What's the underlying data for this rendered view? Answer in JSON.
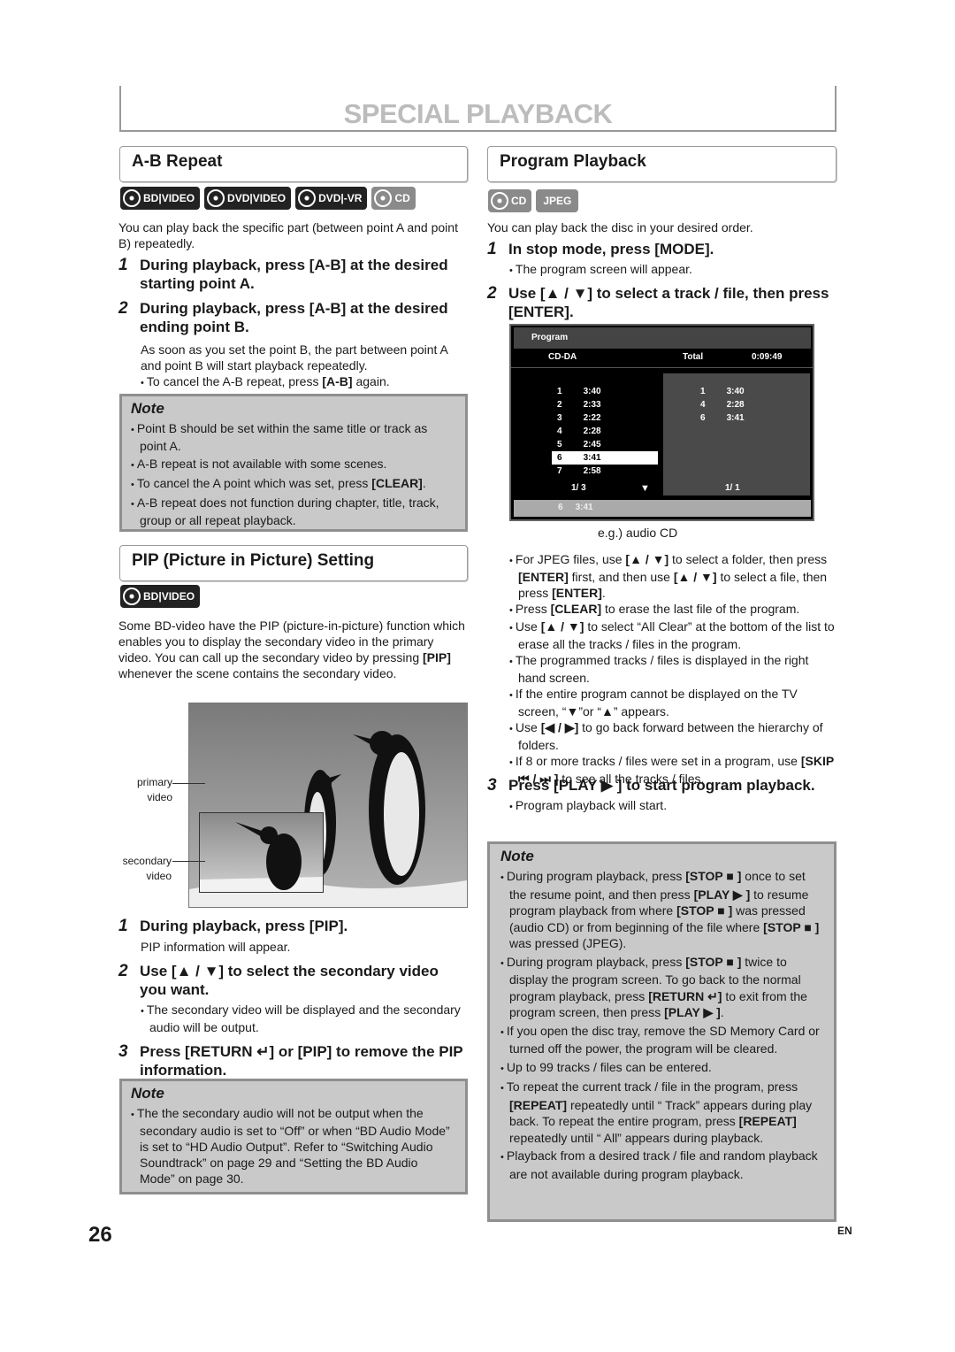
{
  "page_title": "SPECIAL PLAYBACK",
  "ab": {
    "title": "A-B Repeat",
    "discs": [
      "BD|VIDEO",
      "DVD|VIDEO",
      "DVD|-VR",
      "CD"
    ],
    "intro": "You can play back the specific part (between point A and point B) repeatedly.",
    "step1": {
      "n": "1",
      "text": "During playback, press [A-B] at the desired starting point A."
    },
    "step2": {
      "n": "2",
      "text": "During playback, press [A-B] at the desired ending point B."
    },
    "step2_body": "As soon as you set the point B, the part between point A and point B will start playback repeatedly.",
    "step2_bullet": [
      [
        "To cancel the A-B repeat, press ",
        0
      ],
      [
        "[A-B]",
        1
      ],
      [
        " again.",
        0
      ]
    ],
    "note_title": "Note",
    "notes": [
      [
        [
          "Point B should be set within the same title or track as point A.",
          0
        ]
      ],
      [
        [
          "A-B repeat is not available with some scenes.",
          0
        ]
      ],
      [
        [
          "To cancel the A point which was set, press ",
          0
        ],
        [
          "[CLEAR]",
          1
        ],
        [
          ".",
          0
        ]
      ],
      [
        [
          "A-B repeat does not function during chapter, title, track, group or all repeat playback.",
          0
        ]
      ]
    ]
  },
  "pip": {
    "title": "PIP (Picture in Picture) Setting",
    "discs": [
      "BD|VIDEO"
    ],
    "intro": [
      [
        "Some BD-video have the PIP (picture-in-picture) function which enables you to display the secondary video in the primary video. You can call up the secondary video by pressing ",
        0
      ],
      [
        "[PIP]",
        1
      ],
      [
        " whenever the scene contains the secondary video.",
        0
      ]
    ],
    "label_primary": "primary video",
    "label_secondary": "secondary video",
    "step1": {
      "n": "1",
      "text": "During playback, press [PIP]."
    },
    "step1_body": "PIP information will appear.",
    "step2": {
      "n": "2",
      "text": "Use [▲ / ▼] to select the secondary video you want."
    },
    "step2_bullet": "The secondary video will be displayed and the secondary audio will be output.",
    "step3": {
      "n": "3",
      "text": "Press [RETURN ↵] or [PIP] to remove the PIP information."
    },
    "note_title": "Note",
    "notes": [
      [
        [
          "The the secondary audio will not be output when the secondary audio is set to “Off” or when “BD Audio Mode” is set to “HD Audio Output”. Refer to “Switching Audio Soundtrack” on page 29 and “Setting the BD Audio Mode” on page 30.",
          0
        ]
      ]
    ]
  },
  "program": {
    "title": "Program Playback",
    "discs": [
      "CD",
      "JPEG"
    ],
    "intro": "You can play back the disc in your desired order.",
    "step1": {
      "n": "1",
      "text": "In stop mode, press [MODE]."
    },
    "step1_bullet": "The program screen will appear.",
    "step2": {
      "n": "2",
      "text": "Use [▲ / ▼] to select a track / file, then press [ENTER]."
    },
    "screen": {
      "header": "Program",
      "disc_type": "CD-DA",
      "total_label": "Total",
      "total_time": "0:09:49",
      "tracks": [
        [
          "1",
          "3:40"
        ],
        [
          "2",
          "2:33"
        ],
        [
          "3",
          "2:22"
        ],
        [
          "4",
          "2:28"
        ],
        [
          "5",
          "2:45"
        ],
        [
          "6",
          "3:41"
        ],
        [
          "7",
          "2:58"
        ]
      ],
      "selected_index": 5,
      "left_page": "1/  3",
      "programmed": [
        [
          "1",
          "3:40"
        ],
        [
          "4",
          "2:28"
        ],
        [
          "6",
          "3:41"
        ]
      ],
      "right_page": "1/  1",
      "current": [
        "6",
        "3:41"
      ]
    },
    "caption": "e.g.) audio CD",
    "bullets": [
      [
        [
          "For JPEG files, use ",
          0
        ],
        [
          "[▲ / ▼]",
          1
        ],
        [
          " to select a folder, then press ",
          0
        ],
        [
          "[ENTER]",
          1
        ],
        [
          " first, and then use ",
          0
        ],
        [
          "[▲ / ▼]",
          1
        ],
        [
          " to select a file, then press ",
          0
        ],
        [
          "[ENTER]",
          1
        ],
        [
          ".",
          0
        ]
      ],
      [
        [
          "Press ",
          0
        ],
        [
          "[CLEAR]",
          1
        ],
        [
          " to erase the last file of the program.",
          0
        ]
      ],
      [
        [
          "Use ",
          0
        ],
        [
          "[▲ / ▼]",
          1
        ],
        [
          " to select “All Clear” at the bottom of the list to erase all the tracks / files in the program.",
          0
        ]
      ],
      [
        [
          "The programmed tracks / files is displayed in the right hand screen.",
          0
        ]
      ],
      [
        [
          "If the entire program cannot be displayed on the TV screen, “▼”or “▲” appears.",
          0
        ]
      ],
      [
        [
          "Use ",
          0
        ],
        [
          "[◀ / ▶]",
          1
        ],
        [
          " to go back forward between the hierarchy of folders.",
          0
        ]
      ],
      [
        [
          "If 8 or more tracks / files were set in a program, use ",
          0
        ],
        [
          "[SKIP ⏮ / ⏭ ]",
          1
        ],
        [
          " to see all the tracks / files.",
          0
        ]
      ]
    ],
    "step3": {
      "n": "3",
      "text": "Press [PLAY ▶ ] to start program playback."
    },
    "step3_bullet": "Program playback will start.",
    "note_title": "Note",
    "notes": [
      [
        [
          "During program playback, press ",
          0
        ],
        [
          "[STOP ■ ]",
          1
        ],
        [
          " once to set the resume point, and then press ",
          0
        ],
        [
          "[PLAY ▶ ]",
          1
        ],
        [
          " to resume program playback from where ",
          0
        ],
        [
          "[STOP ■ ]",
          1
        ],
        [
          " was pressed (audio CD) or from beginning of the file where ",
          0
        ],
        [
          "[STOP ■ ]",
          1
        ],
        [
          " was pressed (JPEG).",
          0
        ]
      ],
      [
        [
          "During program playback, press ",
          0
        ],
        [
          "[STOP ■ ]",
          1
        ],
        [
          " twice to display the program screen. To go back to the normal program playback, press ",
          0
        ],
        [
          "[RETURN ↵]",
          1
        ],
        [
          " to exit from the program screen, then press ",
          0
        ],
        [
          "[PLAY ▶ ]",
          1
        ],
        [
          ".",
          0
        ]
      ],
      [
        [
          "If you open the disc tray, remove the SD Memory Card or turned off the power, the program will be cleared.",
          0
        ]
      ],
      [
        [
          "Up to 99 tracks / files can be entered.",
          0
        ]
      ],
      [
        [
          "To repeat the current track / file in the program, press ",
          0
        ],
        [
          "[REPEAT]",
          1
        ],
        [
          " repeatedly until “        Track” appears during play back. To repeat the entire program, press ",
          0
        ],
        [
          "[REPEAT]",
          1
        ],
        [
          " repeatedly until “        All” appears during playback.",
          0
        ]
      ],
      [
        [
          "Playback from a desired track / file and random playback are not available during program playback.",
          0
        ]
      ]
    ]
  },
  "page_number": "26",
  "language": "EN"
}
